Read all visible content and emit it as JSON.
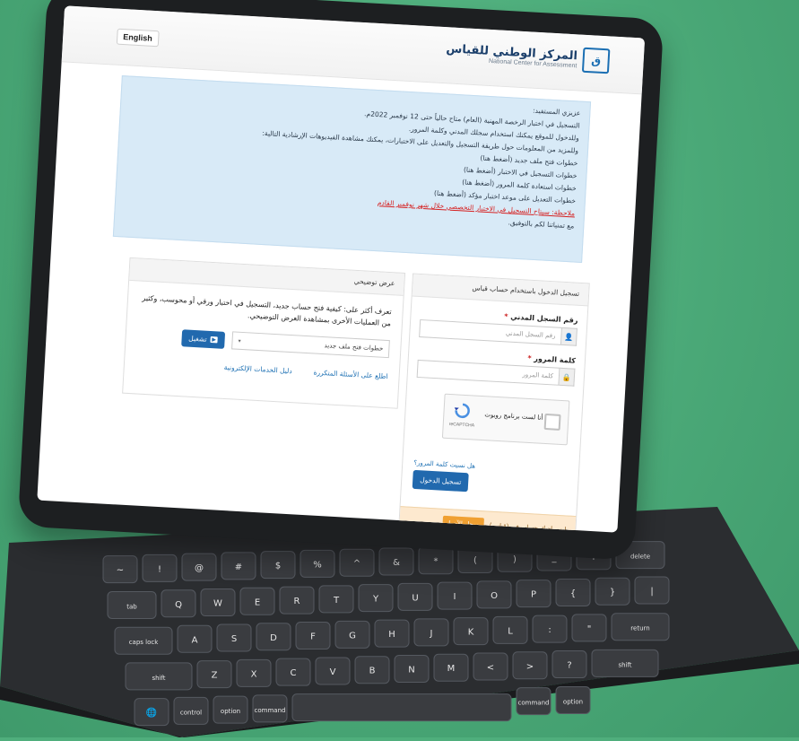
{
  "header": {
    "lang_button": "English",
    "logo_ar": "المركز الوطني للقياس",
    "logo_en": "National Center for Assessment"
  },
  "notice": {
    "lines": [
      "عزيزي المستفيد:",
      "التسجيل في اختبار الرخصة المهنية (العام) متاح حالياً حتى 12 نوفمبر 2022م.",
      "وللدخول للموقع يمكنك استخدام سجلك المدني وكلمة المرور.",
      "وللمزيد من المعلومات حول طريقة التسجيل والتعديل على الاختبارات، يمكنك مشاهدة الفيديوهات الإرشادية التالية:",
      "خطوات فتح ملف جديد (أضغط هنا)",
      "خطوات التسجيل في الاختبار (أضغط هنا)",
      "خطوات استعادة كلمة المرور (أضغط هنا)",
      "خطوات التعديل على موعد اختبار مؤكد (أضغط هنا)",
      "ملاحظة: سيتاح التسجيل في الاختبار التخصصي خلال شهر نوفمبر القادم",
      "مع تمنياتنا لكم بالتوفيق."
    ]
  },
  "login": {
    "title": "تسجيل الدخول باستخدام حساب قياس",
    "id_label": "رقم السجل المدني",
    "id_placeholder": "رقم السجل المدني",
    "password_label": "كلمة المرور",
    "password_placeholder": "كلمة المرور",
    "captcha_label": "أنا لست برنامج روبوت",
    "captcha_brand": "reCAPTCHA",
    "forgot_link": "هل نسيت كلمة المرور؟",
    "submit": "تسجيل الدخول",
    "register_text": "ليس لديك حساب في (قياس)",
    "register_button": "سجل الآن !"
  },
  "demo": {
    "title": "عرض توضيحي",
    "description": "تعرف أكثر على: كيفية فتح حساب جديد، التسجيل في اختبار ورقي أو محوسب، وكثير من العمليات الأخرى بمشاهدة العرض التوضيحي.",
    "select_value": "خطوات فتح ملف جديد",
    "play_button": "تشغيل",
    "links": [
      "اطلع على الأسئلة المتكررة",
      "دليل الخدمات الإلكترونية"
    ]
  },
  "colors": {
    "background": "#4fae7c",
    "primary": "#2169ae",
    "warning_text": "#d62020",
    "register_button": "#f0a032"
  },
  "keyboard": {
    "row1": [
      "~",
      "!",
      "@",
      "#",
      "$",
      "%",
      "^",
      "&",
      "*",
      "(",
      ")",
      "_",
      "+",
      "delete"
    ],
    "row2": [
      "tab",
      "Q",
      "W",
      "E",
      "R",
      "T",
      "Y",
      "U",
      "I",
      "O",
      "P",
      "{",
      "}",
      "|"
    ],
    "row3": [
      "caps lock",
      "A",
      "S",
      "D",
      "F",
      "G",
      "H",
      "J",
      "K",
      "L",
      ":",
      "\"",
      "return"
    ],
    "row4": [
      "shift",
      "Z",
      "X",
      "C",
      "V",
      "B",
      "N",
      "M",
      "<",
      ">",
      "?",
      "shift"
    ],
    "row5": [
      "🌐",
      "control",
      "option",
      "command",
      "",
      "command",
      "option"
    ]
  }
}
